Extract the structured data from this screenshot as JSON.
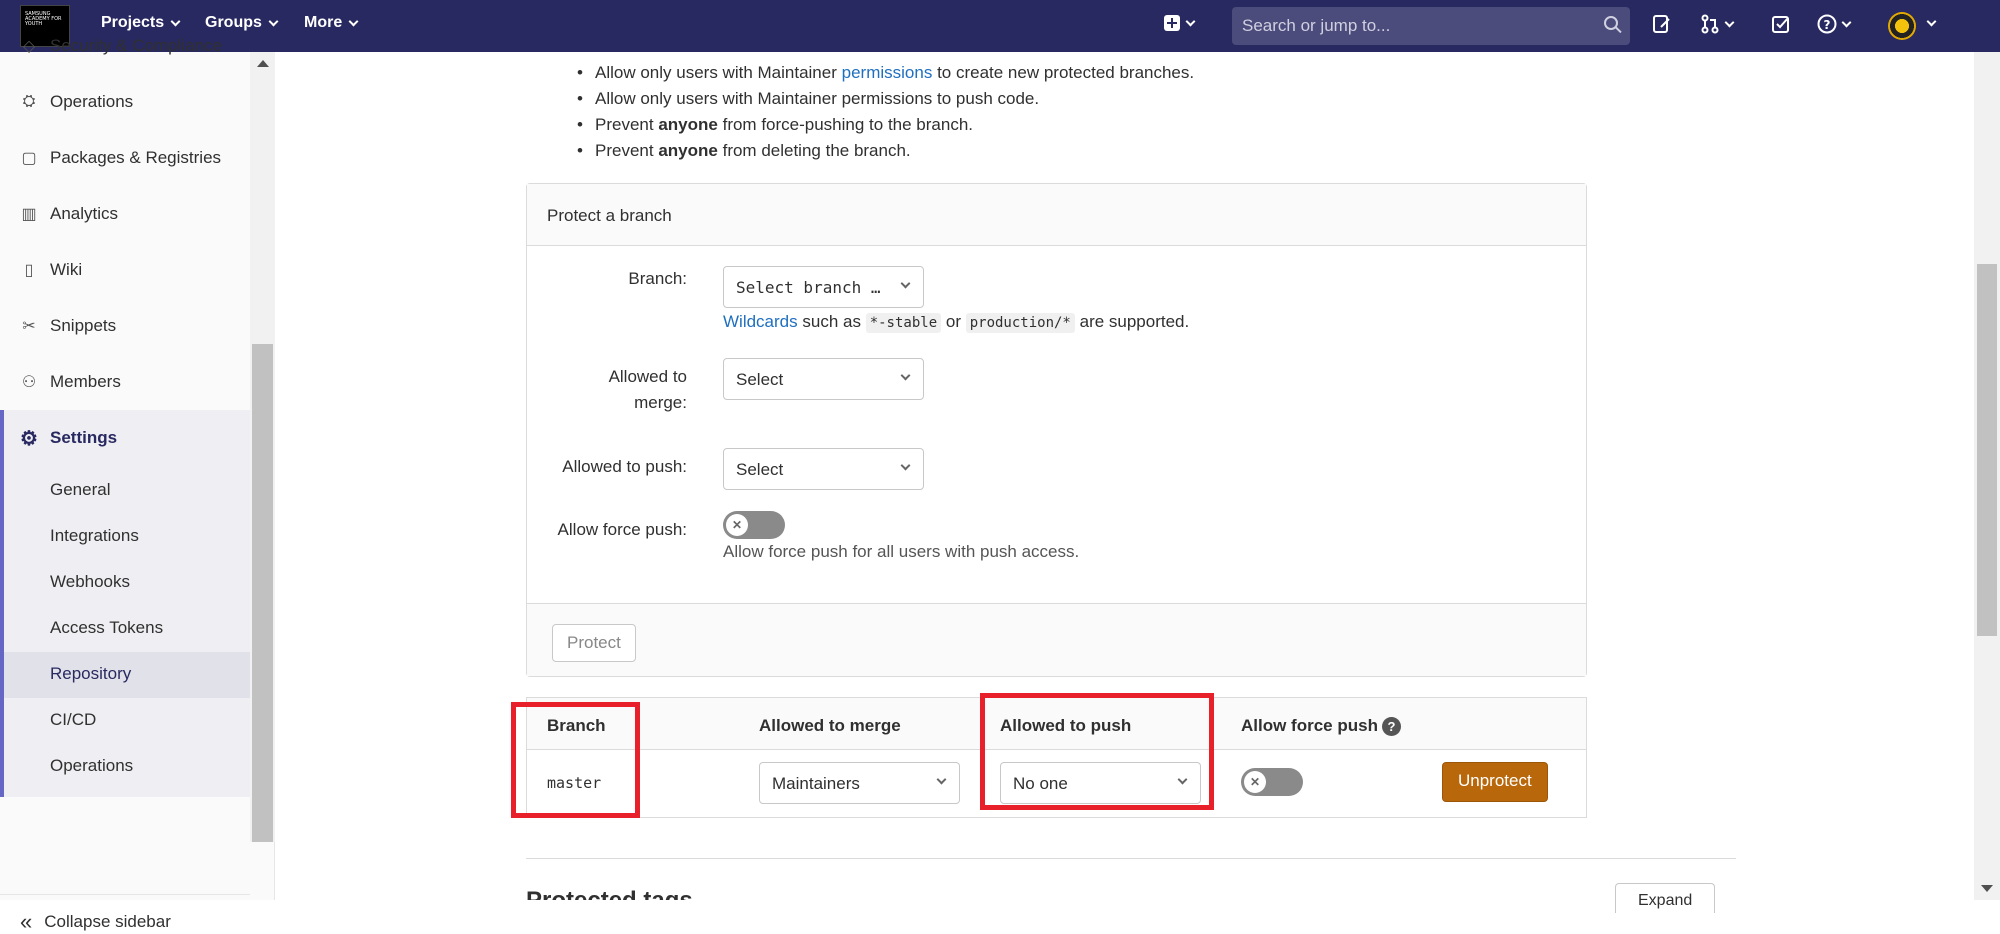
{
  "topbar": {
    "logo_text": "SAMSUNG ACADEMY FOR YOUTH",
    "projects": "Projects",
    "groups": "Groups",
    "more": "More",
    "search_placeholder": "Search or jump to..."
  },
  "sidebar": {
    "top_cut": "Security & Compliance",
    "items": [
      {
        "label": "Operations",
        "icon": "rocket-icon"
      },
      {
        "label": "Packages & Registries",
        "icon": "package-icon"
      },
      {
        "label": "Analytics",
        "icon": "chart-icon"
      },
      {
        "label": "Wiki",
        "icon": "book-icon"
      },
      {
        "label": "Snippets",
        "icon": "scissors-icon"
      },
      {
        "label": "Members",
        "icon": "users-icon"
      }
    ],
    "settings": "Settings",
    "sub": [
      "General",
      "Integrations",
      "Webhooks",
      "Access Tokens",
      "Repository",
      "CI/CD",
      "Operations"
    ],
    "collapse": "Collapse sidebar"
  },
  "intro": {
    "b1_pre": "Allow only users with Maintainer",
    "b1_link": "permissions",
    "b1_post": "to create new protected branches.",
    "b2": "Allow only users with Maintainer permissions to push code.",
    "b3_pre": "Prevent",
    "b3_bold": "anyone",
    "b3_post": "from force-pushing to the branch.",
    "b4_pre": "Prevent",
    "b4_bold": "anyone",
    "b4_post": "from deleting the branch."
  },
  "protect_form": {
    "title": "Protect a branch",
    "branch_label": "Branch:",
    "branch_value": "Select branch …",
    "wildcards_link": "Wildcards",
    "wildcards_mid": "such as",
    "code1": "*-stable",
    "or": "or",
    "code2": "production/*",
    "supported": "are supported.",
    "merge_label_1": "Allowed to",
    "merge_label_2": "merge:",
    "merge_value": "Select",
    "push_label": "Allowed to push:",
    "push_value": "Select",
    "force_label": "Allow force push:",
    "force_help": "Allow force push for all users with push access.",
    "protect_button": "Protect"
  },
  "table": {
    "headers": [
      "Branch",
      "Allowed to merge",
      "Allowed to push",
      "Allow force push"
    ],
    "row": {
      "branch": "master",
      "merge": "Maintainers",
      "push": "No one",
      "unprotect": "Unprotect"
    },
    "highlight_color": "#e8202a"
  },
  "section2": {
    "title": "Protected tags",
    "expand": "Expand"
  }
}
